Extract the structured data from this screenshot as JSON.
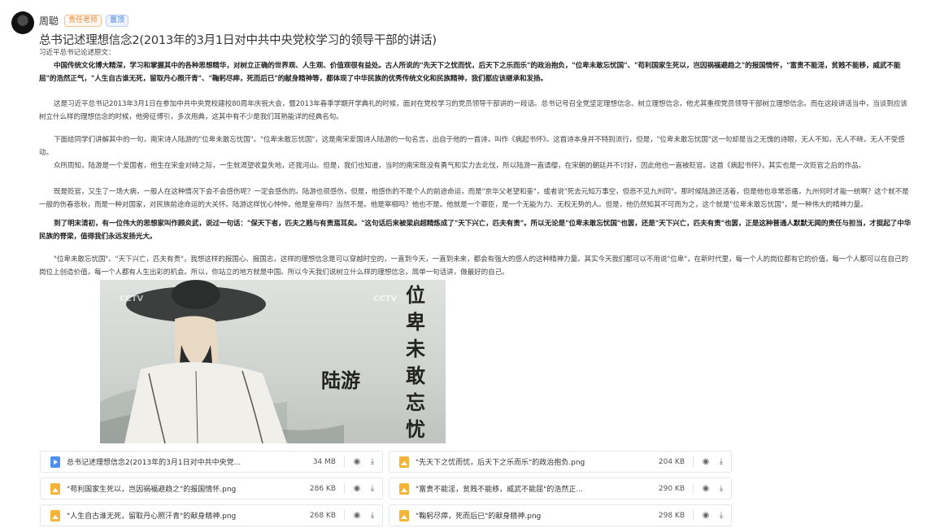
{
  "post": {
    "author": "周聪",
    "badges": {
      "teacher": "责任老师",
      "pinned": "置顶"
    },
    "title": "总书记述理想信念2(2013年的3月1日对中共中央党校学习的领导干部的讲话)",
    "p0": "习近平总书记论述原文：",
    "p1": "中国传统文化博大精深，学习和掌握其中的各种思想精华，对树立正确的世界观、人生观、价值观很有益处。古人所说的\"先天下之忧而忧，后天下之乐而乐\"的政治抱负，\"位卑未敢忘忧国\"、\"苟利国家生死以，岂因祸福避趋之\"的报国情怀，\"富贵不能淫，贫贱不能移，威武不能屈\"的浩然正气，\"人生自古谁无死，留取丹心照汗青\"、\"鞠躬尽瘁，死而后已\"的献身精神等，都体现了中华民族的优秀传统文化和民族精神，我们都应该继承和发扬。",
    "p2": "这是习近平总书记2013年3月1日在参加中共中央党校建校80周年庆祝大会，暨2013年春季学期开学典礼的时候，面对在党校学习的党员领导干部讲的一段话。总书记号召全党坚定理想信念、树立理想信念，他尤其重视党员领导干部树立理想信念。而在这段讲话当中，当谈到应该树立什么样的理想信念的时候，他旁征博引，多次用典，这其中有不少是我们耳熟能详的经典名句。",
    "p3": "下面给同学们讲解其中的一句，南宋诗人陆游的\"位卑未敢忘忧国\"。\"位卑未敢忘忧国\"，这是南宋爱国诗人陆游的一句名言，出自于他的一首诗，叫作《病起书怀》。这首诗本身并不特别流行，但是，\"位卑未敢忘忧国\"这一句却是当之无愧的诗眼，无人不知，无人不晓，无人不受感动。",
    "p4": "众所周知，陆游是一个爱国者，他生在宋金对峙之际，一生就渴望收复失地，还我河山。但是，我们也知道，当时的南宋既没有勇气和实力去北伐，所以陆游一直请缨，在宋朝的朝廷并不讨好，因此他也一直被贬官。这首《病起书怀》，其实也是一次贬官之后的作品。",
    "p5": "既是贬官，又生了一场大病，一般人在这种情况下会不会感伤呢？一定会感伤的。陆游也很感伤，但是，他感伤的不是个人的前途命运，而是\"京华父老望和銮\"，或者说\"死去元知万事空，但悲不见九州同\"。那时候陆游还活着，但是他也非常悲痛，九州何时才能一统啊？这个就不是一般的伤春悲秋，而是一种对国家，对民族前途命运的大关怀。陆游这样忧心忡忡，他是皇帝吗？当然不是。他是宰相吗？他也不是。他就是一个罪臣，是一个无能为力、无权无势的人。但是，他仍然知其不可而为之，这个就是\"位卑未敢忘忧国\"，是一种伟大的精神力量。",
    "p6": "到了明末清初，有一位伟大的思想家叫作顾炎武，说过一句话：\"保天下者，匹夫之贱与有责焉耳矣。\"这句话后来被梁启超精炼成了\"天下兴亡，匹夫有责\"。所以无论是\"位卑未敢忘忧国\"也罢，还是\"天下兴亡，匹夫有责\"也罢，正是这种普通人默默无闻的责任与担当，才挺起了中华民族的脊梁，值得我们永远发扬光大。",
    "p7": "\"位卑未敢忘忧国\"、\"天下兴亡，匹夫有责\"，我想这样的报国心、报国志，这样的理想信念是可以穿越时空的，一直到今天，一直到未来，都会有强大的感人的这种精神力量。其实今天我们都可以不用说\"位卑\"，在新时代里，每一个人的岗位都有它的价值，每一个人都可以在自己的岗位上创造价值，每一个人都有人生出彩的机会。所以，你站立的地方就是中国。所以今天我们说树立什么样的理想信念，简单一句话讲，做最好的自己。",
    "illustration": {
      "calligraphy": "位卑未敢忘忧国",
      "name": "陆游",
      "watermark": "CCTV"
    }
  },
  "attachments": [
    {
      "name": "总书记述理想信念2(2013年的3月1日对中共中央党...",
      "size": "34 MB",
      "type": "video"
    },
    {
      "name": "\"先天下之忧而忧，后天下之乐而乐\"的政治抱负.png",
      "size": "204 KB",
      "type": "image"
    },
    {
      "name": "\"苟利国家生死以，岂因祸福避趋之\"的报国情怀.png",
      "size": "286 KB",
      "type": "image"
    },
    {
      "name": "\"富贵不能淫，贫贱不能移，威武不能屈\"的浩然正...",
      "size": "290 KB",
      "type": "image"
    },
    {
      "name": "\"人生自古谁无死，留取丹心照汗青\"的献身精神.png",
      "size": "268 KB",
      "type": "image"
    },
    {
      "name": "\"鞠躬尽瘁，死而后已\"的献身精神.png",
      "size": "298 KB",
      "type": "image"
    }
  ],
  "icons": {
    "preview": "eye-icon",
    "download": "download-icon",
    "video": "video-file-icon",
    "image": "image-file-icon"
  },
  "colors": {
    "teacher_badge": "#e8893a",
    "pinned_badge": "#4a7fd6",
    "video_icon": "#4c8ff0",
    "image_icon": "#f3b437"
  }
}
